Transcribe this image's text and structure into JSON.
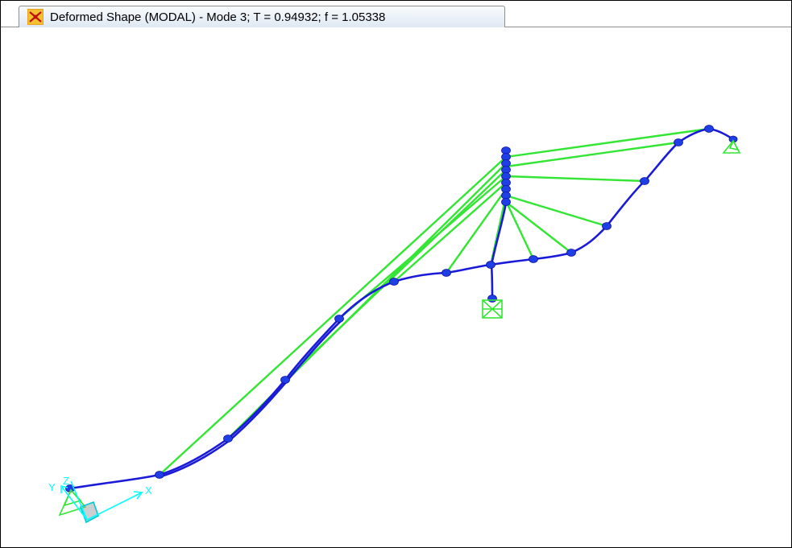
{
  "window": {
    "tab_title": "Deformed Shape (MODAL) - Mode 3; T = 0.94932;  f = 1.05338",
    "tab_icon": "sap2000-app-icon"
  },
  "viewport": {
    "axes": {
      "x_label": "X",
      "y_label": "Y",
      "z_label": "Z",
      "color": "#00ffff"
    },
    "colors": {
      "deformed_frame": "#1a1ad9",
      "joint": "#1f3fe6",
      "cable": "#33e633",
      "support": "#33e633"
    }
  }
}
